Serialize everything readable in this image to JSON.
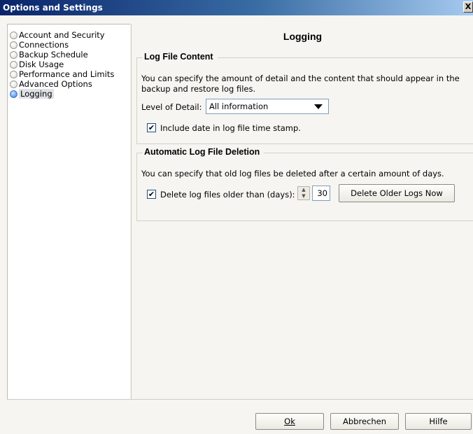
{
  "window": {
    "title": "Options and Settings",
    "close_glyph": "X"
  },
  "sidebar": {
    "items": [
      {
        "label": "Account and Security",
        "selected": false
      },
      {
        "label": "Connections",
        "selected": false
      },
      {
        "label": "Backup Schedule",
        "selected": false
      },
      {
        "label": "Disk Usage",
        "selected": false
      },
      {
        "label": "Performance and Limits",
        "selected": false
      },
      {
        "label": "Advanced Options",
        "selected": false
      },
      {
        "label": "Logging",
        "selected": true
      }
    ]
  },
  "panel": {
    "title": "Logging",
    "log_content": {
      "heading": "Log File Content",
      "description": "You can specify the amount of detail and the content that should appear in the backup and restore log files.",
      "level_label": "Level of Detail:",
      "level_value": "All information",
      "include_date_label": "Include date in log file time stamp.",
      "include_date_checked": true,
      "check_glyph": "✔"
    },
    "log_deletion": {
      "heading": "Automatic Log File Deletion",
      "description": "You can specify that old log files be deleted after a certain amount of days.",
      "delete_label": "Delete log files older than (days):",
      "delete_checked": true,
      "days_value": "30",
      "delete_now_label": "Delete Older Logs Now",
      "spin_up": "▲",
      "spin_down": "▼"
    }
  },
  "footer": {
    "ok_label": "Ok",
    "cancel_label": "Abbrechen",
    "help_label": "Hilfe"
  }
}
